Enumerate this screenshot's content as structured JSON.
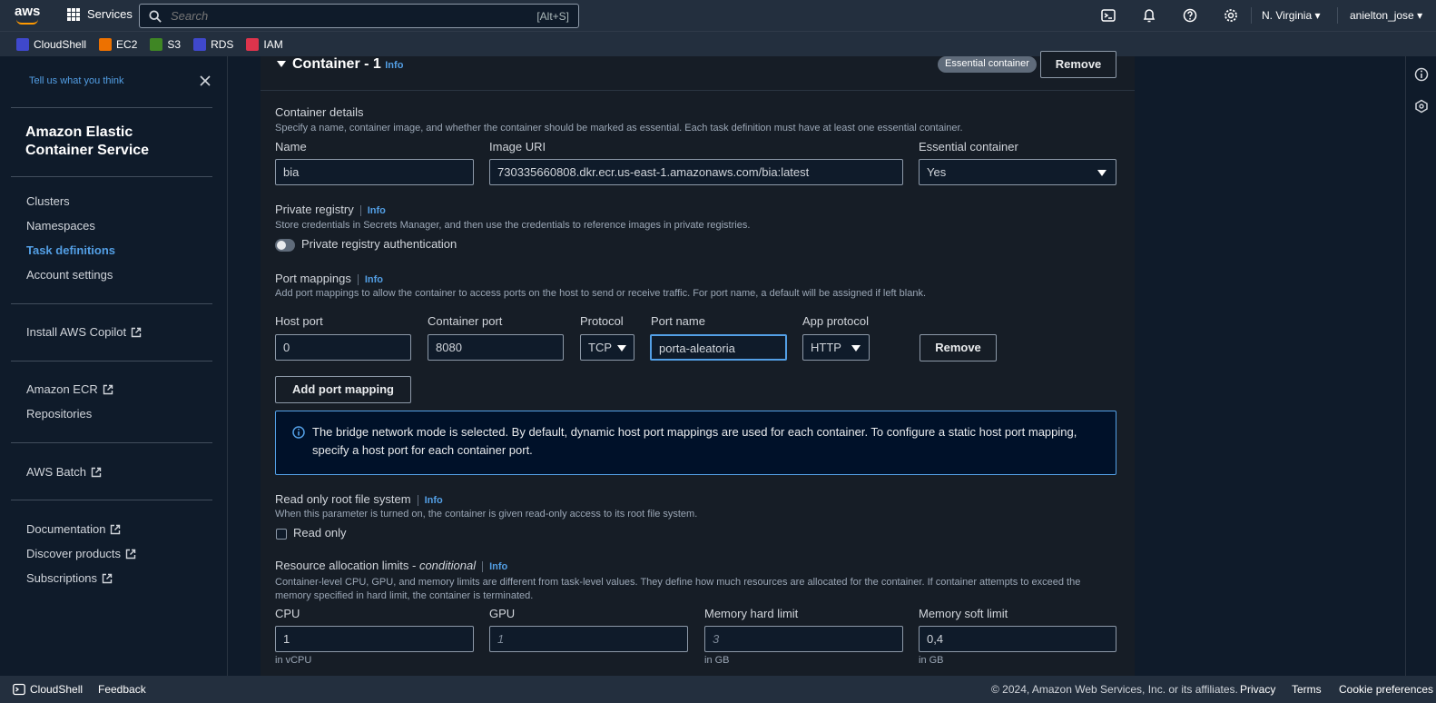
{
  "topnav": {
    "logo_text": "aws",
    "services_label": "Services",
    "search_placeholder": "Search",
    "search_shortcut": "[Alt+S]",
    "region": "N. Virginia",
    "user": "anielton_jose"
  },
  "favorites": [
    {
      "label": "CloudShell",
      "color": "#3f48cc"
    },
    {
      "label": "EC2",
      "color": "#ed7100"
    },
    {
      "label": "S3",
      "color": "#3f8624"
    },
    {
      "label": "RDS",
      "color": "#3f48cc"
    },
    {
      "label": "IAM",
      "color": "#dd344c"
    }
  ],
  "sidebar": {
    "feedback_link": "Tell us what you think",
    "service_title_line1": "Amazon Elastic",
    "service_title_line2": "Container Service",
    "nav": [
      "Clusters",
      "Namespaces",
      "Task definitions",
      "Account settings"
    ],
    "active_item": "Task definitions",
    "copilot": "Install AWS Copilot",
    "ecr": "Amazon ECR",
    "repositories": "Repositories",
    "batch": "AWS Batch",
    "documentation": "Documentation",
    "discover": "Discover products",
    "subscriptions": "Subscriptions"
  },
  "container": {
    "title": "Container - 1",
    "info": "Info",
    "essential_badge": "Essential container",
    "remove_label": "Remove",
    "details_heading": "Container details",
    "details_desc": "Specify a name, container image, and whether the container should be marked as essential. Each task definition must have at least one essential container.",
    "name_label": "Name",
    "name_value": "bia",
    "image_label": "Image URI",
    "image_value": "730335660808.dkr.ecr.us-east-1.amazonaws.com/bia:latest",
    "essential_label": "Essential container",
    "essential_value": "Yes"
  },
  "private_registry": {
    "heading": "Private registry",
    "info": "Info",
    "desc": "Store credentials in Secrets Manager, and then use the credentials to reference images in private registries.",
    "toggle_label": "Private registry authentication"
  },
  "port_mappings": {
    "heading": "Port mappings",
    "info": "Info",
    "desc": "Add port mappings to allow the container to access ports on the host to send or receive traffic. For port name, a default will be assigned if left blank.",
    "host_port_label": "Host port",
    "host_port_value": "0",
    "container_port_label": "Container port",
    "container_port_value": "8080",
    "protocol_label": "Protocol",
    "protocol_value": "TCP",
    "port_name_label": "Port name",
    "port_name_value": "porta-aleatoria",
    "app_protocol_label": "App protocol",
    "app_protocol_value": "HTTP",
    "remove_label": "Remove",
    "add_label": "Add port mapping",
    "alert_text": "The bridge network mode is selected. By default, dynamic host port mappings are used for each container. To configure a static host port mapping, specify a host port for each container port."
  },
  "readonly_fs": {
    "heading": "Read only root file system",
    "info": "Info",
    "desc": "When this parameter is turned on, the container is given read-only access to its root file system.",
    "checkbox_label": "Read only"
  },
  "resources": {
    "heading": "Resource allocation limits - ",
    "heading_em": "conditional",
    "info": "Info",
    "desc": "Container-level CPU, GPU, and memory limits are different from task-level values. They define how much resources are allocated for the container. If container attempts to exceed the memory specified in hard limit, the container is terminated.",
    "cpu_label": "CPU",
    "cpu_value": "1",
    "cpu_unit": "in vCPU",
    "gpu_label": "GPU",
    "gpu_placeholder": "1",
    "mem_hard_label": "Memory hard limit",
    "mem_hard_placeholder": "3",
    "mem_hard_unit": "in GB",
    "mem_soft_label": "Memory soft limit",
    "mem_soft_value": "0,4",
    "mem_soft_unit": "in GB"
  },
  "footer": {
    "cloudshell": "CloudShell",
    "feedback": "Feedback",
    "copyright": "© 2024, Amazon Web Services, Inc. or its affiliates.",
    "privacy": "Privacy",
    "terms": "Terms",
    "cookies": "Cookie preferences"
  }
}
